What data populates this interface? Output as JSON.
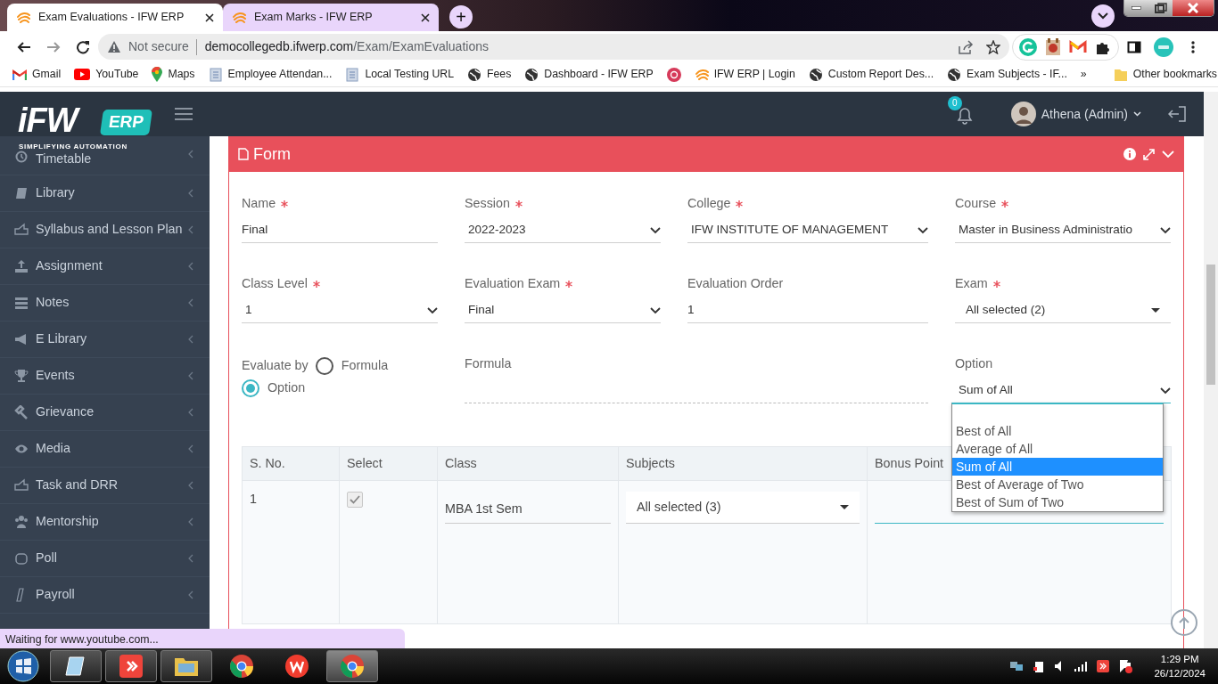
{
  "browser": {
    "tabs": [
      {
        "title": "Exam Evaluations - IFW ERP",
        "selected": true
      },
      {
        "title": "Exam Marks - IFW ERP",
        "selected": false
      }
    ],
    "new_tab": "+",
    "address": {
      "security": "Not secure",
      "host": "democollegedb.ifwerp.com",
      "path": "/Exam/ExamEvaluations"
    },
    "bookmarks": [
      {
        "label": "Gmail",
        "kind": "gmail"
      },
      {
        "label": "YouTube",
        "kind": "youtube"
      },
      {
        "label": "Maps",
        "kind": "maps"
      },
      {
        "label": "Employee Attendan...",
        "kind": "page"
      },
      {
        "label": "Local Testing URL",
        "kind": "page"
      },
      {
        "label": "Fees",
        "kind": "globe"
      },
      {
        "label": "Dashboard - IFW ERP",
        "kind": "globe"
      },
      {
        "kind": "app"
      },
      {
        "label": "IFW ERP | Login",
        "kind": "ifw"
      },
      {
        "label": "Custom Report Des...",
        "kind": "globe"
      },
      {
        "label": "Exam Subjects - IF...",
        "kind": "globe"
      }
    ],
    "overflow": "»",
    "other_bookmarks": "Other bookmarks"
  },
  "app": {
    "logo": {
      "brand": "iFW",
      "badge": "ERP",
      "tagline": "SIMPLIFYING AUTOMATION"
    },
    "notifications": "0",
    "user": "Athena (Admin)"
  },
  "sidebar": {
    "items": [
      "Timetable",
      "Library",
      "Syllabus and Lesson Plan",
      "Assignment",
      "Notes",
      "E Library",
      "Events",
      "Grievance",
      "Media",
      "Task and DRR",
      "Mentorship",
      "Poll",
      "Payroll"
    ]
  },
  "form": {
    "title": "Form",
    "fields": [
      {
        "label": "Name",
        "required": true,
        "value": "Final",
        "kind": "text"
      },
      {
        "label": "Session",
        "required": true,
        "value": "2022-2023",
        "kind": "select"
      },
      {
        "label": "College",
        "required": true,
        "value": "IFW INSTITUTE OF MANAGEMENT",
        "kind": "select"
      },
      {
        "label": "Course",
        "required": true,
        "value": "Master in Business Administratio",
        "kind": "select"
      },
      {
        "label": "Class Level",
        "required": true,
        "value": "1",
        "kind": "select"
      },
      {
        "label": "Evaluation Exam",
        "required": true,
        "value": "Final",
        "kind": "select"
      },
      {
        "label": "Evaluation Order",
        "required": false,
        "value": "1",
        "kind": "text"
      },
      {
        "label": "Exam",
        "required": true,
        "value": "All selected (2)",
        "kind": "multiselect"
      }
    ],
    "evaluate_by": {
      "label": "Evaluate by",
      "options": [
        {
          "label": "Formula",
          "selected": false
        },
        {
          "label": "Option",
          "selected": true
        }
      ]
    },
    "formula": {
      "label": "Formula"
    },
    "option": {
      "label": "Option",
      "value": "Sum of All",
      "expanded": true,
      "options": [
        {
          "label": "Best of All",
          "selected": false
        },
        {
          "label": "Average of All",
          "selected": false
        },
        {
          "label": "Sum of All",
          "selected": true
        },
        {
          "label": "Best of Average of Two",
          "selected": false
        },
        {
          "label": "Best of Sum of Two",
          "selected": false
        }
      ]
    },
    "table": {
      "columns": [
        "S. No.",
        "Select",
        "Class",
        "Subjects",
        "Bonus Point"
      ],
      "rows": [
        {
          "s_no": "1",
          "checked": true,
          "class": "MBA 1st Sem",
          "subjects": "All selected (3)"
        }
      ]
    }
  },
  "status_bubble": "Waiting for www.youtube.com...",
  "taskbar": {
    "apps": [
      {
        "kind": "notes",
        "running": true,
        "selected": false
      },
      {
        "kind": "remote",
        "running": true,
        "selected": false
      },
      {
        "kind": "folder",
        "running": true,
        "selected": false
      },
      {
        "kind": "chrome",
        "running": false,
        "selected": false
      },
      {
        "kind": "office",
        "running": false,
        "selected": false
      },
      {
        "kind": "chrome",
        "running": true,
        "selected": true
      }
    ],
    "time": "1:29 PM",
    "date": "26/12/2024"
  }
}
